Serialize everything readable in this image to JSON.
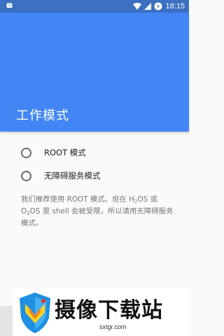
{
  "status_bar": {
    "time": "18:15",
    "icons": [
      "android-notification-icon",
      "wifi-icon",
      "cell-signal-icon",
      "battery-charging-icon"
    ]
  },
  "app_bar": {
    "title": "工作模式",
    "color": "#4285f4"
  },
  "options": [
    {
      "label": "ROOT 模式",
      "selected": false
    },
    {
      "label": "无障碍服务模式",
      "selected": false
    }
  ],
  "description": {
    "part1": "我们推荐使用 ROOT 模式。但在 H",
    "sub1": "2",
    "part2": "OS 或 O",
    "sub2": "2",
    "part3": "OS 里 shell 会被受限，所以请用无障碍服务模式。"
  },
  "watermark": {
    "text": "摄像下载站",
    "url": "sxtgr.com"
  }
}
